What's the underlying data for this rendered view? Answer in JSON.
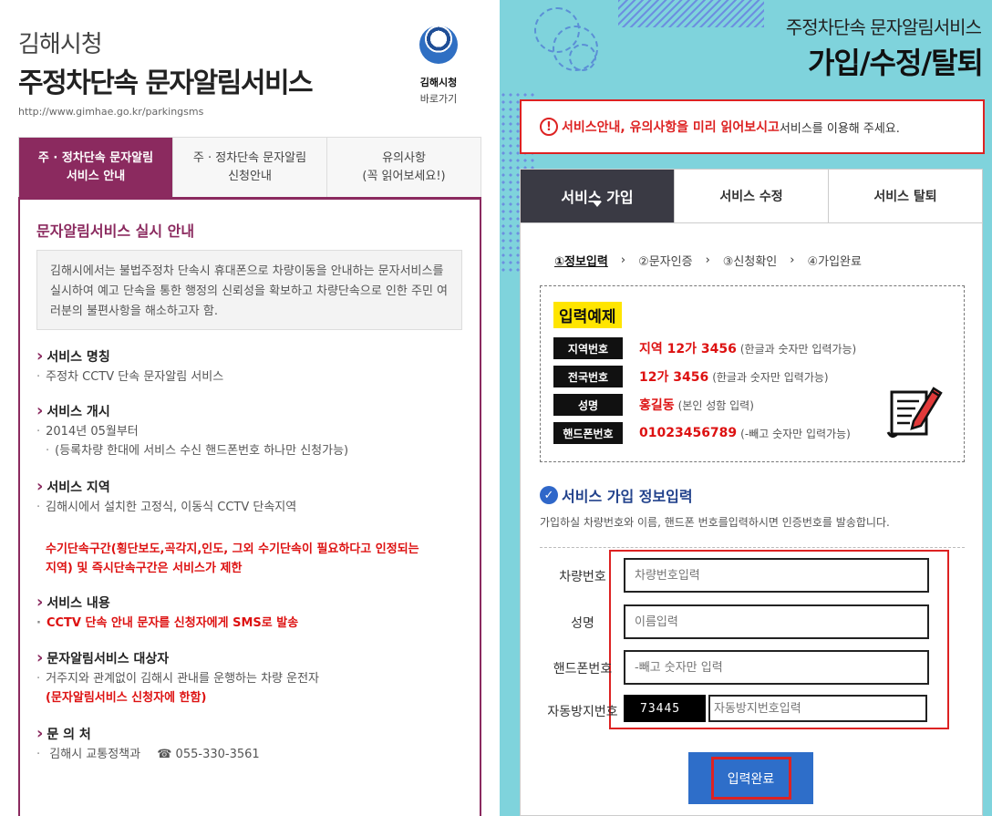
{
  "left": {
    "city": "김해시청",
    "title": "주정차단속 문자알림서비스",
    "url": "http://www.gimhae.go.kr/parkingsms",
    "logo": {
      "name": "김해시청",
      "link": "바로가기",
      "icon": "gimhae-emblem-icon"
    },
    "tabs": [
      {
        "line1": "주 · 정차단속 문자알림",
        "line2": "서비스 안내"
      },
      {
        "line1": "주 · 정차단속 문자알림",
        "line2": "신청안내"
      },
      {
        "line1": "유의사항",
        "line2": "(꼭 읽어보세요!)"
      }
    ],
    "heading": "문자알림서비스 실시 안내",
    "intro": "김해시에서는 불법주정차 단속시 휴대폰으로 차량이동을 안내하는 문자서비스를 실시하여 예고 단속을 통한 행정의 신뢰성을 확보하고 차량단속으로 인한 주민 여러분의 불편사항을 해소하고자 함.",
    "sections": {
      "name": {
        "h": "서비스 명칭",
        "b1": "주정차 CCTV 단속 문자알림 서비스"
      },
      "start": {
        "h": "서비스 개시",
        "b1": "2014년 05월부터",
        "b2": "(등록차량 한대에 서비스 수신 핸드폰번호 하나만 신청가능)"
      },
      "area": {
        "h": "서비스 지역",
        "b1": "김해시에서 설치한 고정식, 이동식 CCTV 단속지역",
        "warn1": "수기단속구간(횡단보도,곡각지,인도, 그외 수기단속이 필요하다고 인정되는",
        "warn2": "지역) 및 즉시단속구간은 서비스가 제한"
      },
      "content": {
        "h": "서비스 내용",
        "b1": "CCTV 단속 안내 문자를 신청자에게 SMS로 발송"
      },
      "target": {
        "h": "문자알림서비스 대상자",
        "b1": "거주지와 관계없이 김해시 관내를 운행하는 차량 운전자",
        "b2": "(문자알림서비스 신청자에 한함)"
      },
      "contact": {
        "h": "문 의 처",
        "b1": "김해시 교통정책과",
        "phone": "☎ 055-330-3561"
      }
    }
  },
  "right": {
    "subtitle": "주정차단속 문자알림서비스",
    "title": "가입/수정/탈퇴",
    "notice": {
      "bold": "서비스안내, 유의사항을 미리 읽어보시고",
      "rest": " 서비스를 이용해 주세요.",
      "icon": "warning-circle-icon"
    },
    "tabs": [
      "서비스 가입",
      "서비스 수정",
      "서비스 탈퇴"
    ],
    "steps": [
      "①정보입력",
      "②문자인증",
      "③신청확인",
      "④가입완료"
    ],
    "example": {
      "title": "입력예제",
      "rows": [
        {
          "label": "지역번호",
          "value": "지역 12가 3456",
          "note": "(한글과 숫자만 입력가능)"
        },
        {
          "label": "전국번호",
          "value": "12가 3456",
          "note": "(한글과 숫자만 입력가능)"
        },
        {
          "label": "성명",
          "value": "홍길동",
          "note": "(본인 성함 입력)"
        },
        {
          "label": "핸드폰번호",
          "value": "01023456789",
          "note": "(-빼고 숫자만 입력가능)"
        }
      ]
    },
    "form": {
      "heading": "서비스 가입 정보입력",
      "desc": "가입하실 차량번호와 이름, 핸드폰 번호를입력하시면 인증번호를 발송합니다.",
      "fields": [
        {
          "label": "차량번호",
          "placeholder": "차량번호입력"
        },
        {
          "label": "성명",
          "placeholder": "이름입력"
        },
        {
          "label": "핸드폰번호",
          "placeholder": "-빼고 숫자만 입력"
        }
      ],
      "captcha": {
        "label": "자동방지번호",
        "code": "73445",
        "placeholder": "자동방지번호입력"
      },
      "submit": "입력완료"
    }
  }
}
